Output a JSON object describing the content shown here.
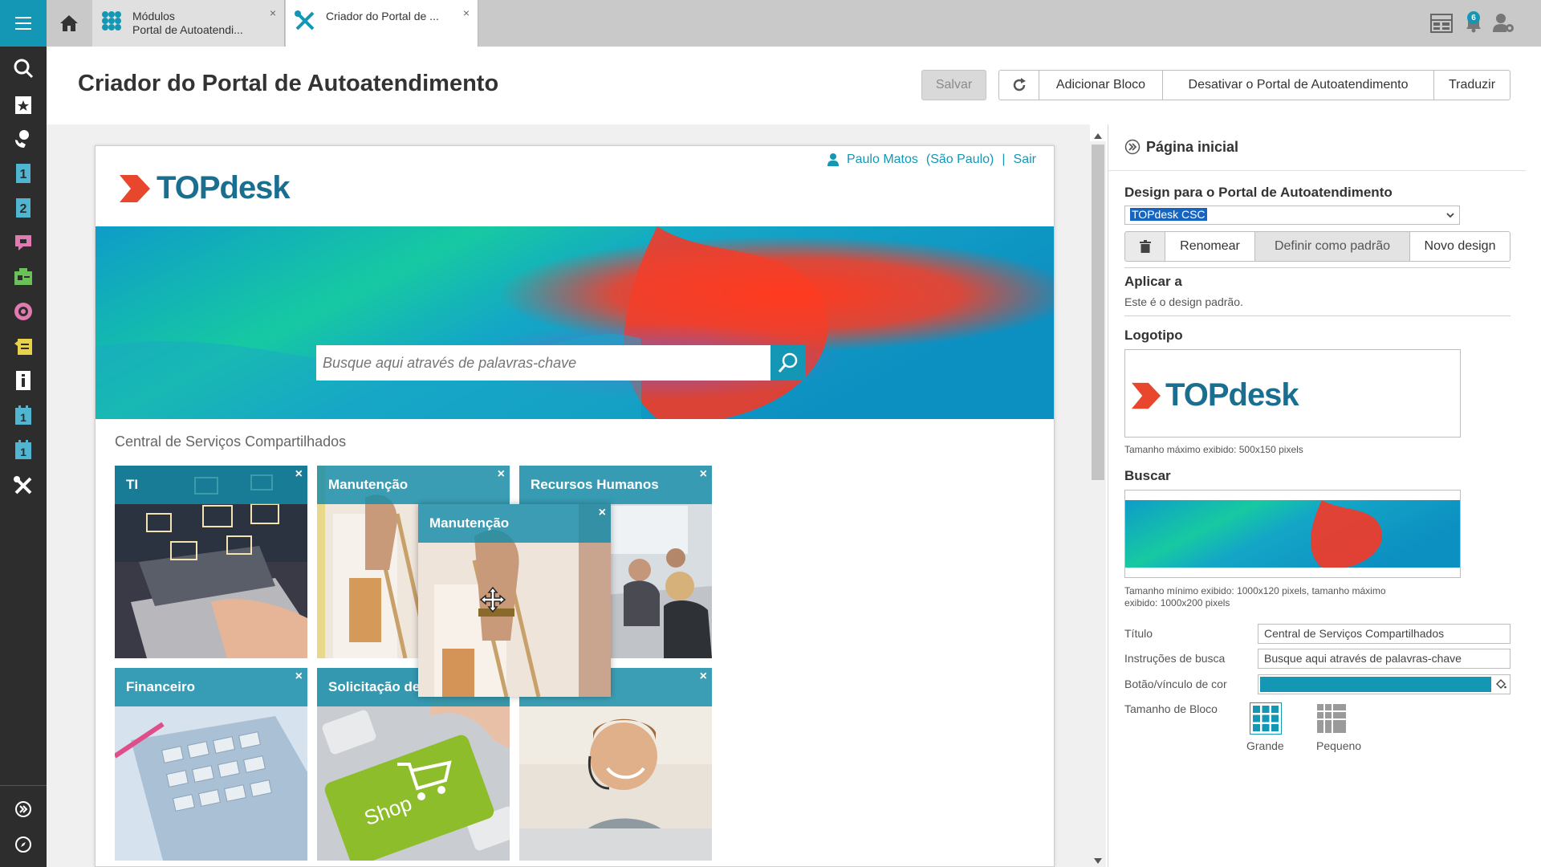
{
  "tabs": [
    {
      "line1": "Módulos",
      "line2": "Portal de Autoatendi...",
      "close": "×"
    },
    {
      "line1": "Criador do Portal de ...",
      "line2": "",
      "close": "×"
    }
  ],
  "notifications_count": "6",
  "header": {
    "title": "Criador do Portal de Autoatendimento",
    "save": "Salvar",
    "add_block": "Adicionar Bloco",
    "deactivate": "Desativar o Portal de Autoatendimento",
    "translate": "Traduzir"
  },
  "portal": {
    "user": "Paulo Matos",
    "location": "(São Paulo)",
    "separator": "|",
    "logout": "Sair",
    "logo_text": "TOPdesk",
    "search_placeholder": "Busque aqui através de palavras-chave",
    "heading": "Central de Serviços Compartilhados",
    "tiles": [
      {
        "label": "TI",
        "close": "×"
      },
      {
        "label": "Manutenção",
        "close": "×"
      },
      {
        "label": "Recursos Humanos",
        "close": "×"
      },
      {
        "label": "Financeiro",
        "close": "×"
      },
      {
        "label": "Solicitação de",
        "close": "×"
      },
      {
        "label": "",
        "close": "×"
      }
    ],
    "dragging_tile": {
      "label": "Manutenção",
      "close": "×"
    },
    "shop_text": "Shop"
  },
  "panel": {
    "title": "Página inicial",
    "design_label": "Design para o Portal de Autoatendimento",
    "design_value": "TOPdesk CSC",
    "rename": "Renomear",
    "set_default": "Definir como padrão",
    "new_design": "Novo design",
    "apply_label": "Aplicar a",
    "apply_text": "Este é o design padrão.",
    "logo_label": "Logotipo",
    "logo_text": "TOPdesk",
    "logo_hint": "Tamanho máximo exibido: 500x150 pixels",
    "search_label": "Buscar",
    "search_hint_1": "Tamanho mínimo exibido: 1000x120 pixels, tamanho máximo",
    "search_hint_2": "exibido: 1000x200 pixels",
    "fields": {
      "title_label": "Título",
      "title_value": "Central de Serviços Compartilhados",
      "search_instr_label": "Instruções de busca",
      "search_instr_value": "Busque aqui através de palavras-chave",
      "color_label": "Botão/vínculo de cor",
      "color_value": "#1497b5",
      "tile_size_label": "Tamanho de Bloco",
      "size_large": "Grande",
      "size_small": "Pequeno"
    }
  },
  "colors": {
    "accent": "#1497b5",
    "rail": "#2d2d2d",
    "logo_red": "#e8472e",
    "logo_blue": "#1a6e8f"
  }
}
